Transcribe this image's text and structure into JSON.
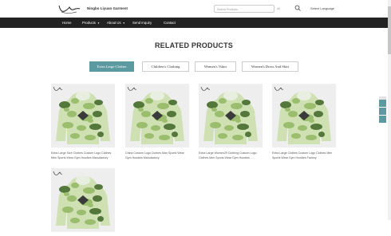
{
  "header": {
    "company": "Ningbo Liyuan Garment",
    "search_placeholder": "Search Products",
    "language": "Select Language",
    "search_select": "All"
  },
  "nav": {
    "items": [
      {
        "label": "Home"
      },
      {
        "label": "Products"
      },
      {
        "label": "About Us"
      },
      {
        "label": "Send Inquiry"
      },
      {
        "label": "Contact"
      }
    ]
  },
  "section": {
    "title": "RELATED PRODUCTS"
  },
  "tabs": [
    {
      "label": "Extra Large Clothes",
      "active": true
    },
    {
      "label": "Children's Clothing",
      "active": false
    },
    {
      "label": "Women's Tshirt",
      "active": false
    },
    {
      "label": "Women's Dress And Skirt",
      "active": false
    }
  ],
  "products": [
    {
      "caption": "Extra Large Size Clothes Custom Logo Clothes Men Sports Wear Gym Hoodies Manufactory"
    },
    {
      "caption": "China Custom Logo Clothes Man Sports Wear Gym Hoodies Manufactory"
    },
    {
      "caption": "Extra Large Women29 Clothing Custom Logo Clothes Men Sports Wear Gym Hoodies ..."
    },
    {
      "caption": "Extra Large Clothes Custom Logo Clothes Men Sports Wear Gym Hoodies Factory"
    },
    {
      "caption": ""
    }
  ],
  "colors": {
    "accent": "#5b9aa0",
    "nav_bg": "#222222",
    "camo_light": "#cfe0b2",
    "camo_mid": "#9bbd6e",
    "camo_dark": "#54783c"
  }
}
